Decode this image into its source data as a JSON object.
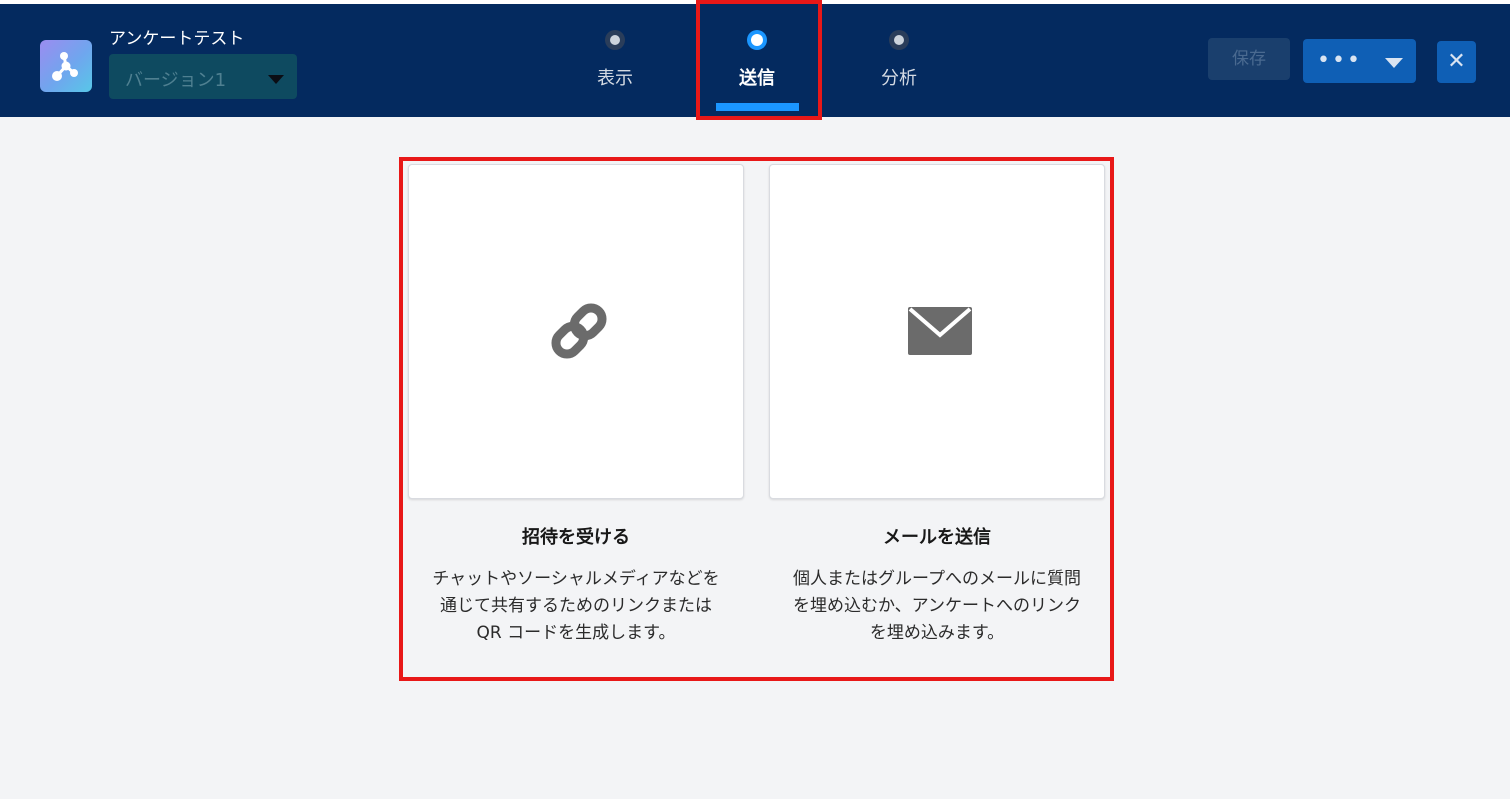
{
  "header": {
    "app_title": "アンケートテスト",
    "version_selected": "バージョン1",
    "steps": [
      {
        "label": "表示",
        "active": false
      },
      {
        "label": "送信",
        "active": true
      },
      {
        "label": "分析",
        "active": false
      }
    ],
    "save_label": "保存",
    "more_label": "•••",
    "close_label": "✕"
  },
  "cards": [
    {
      "icon": "link-icon",
      "title": "招待を受ける",
      "description": [
        "チャットやソーシャルメディアなどを",
        "通じて共有するためのリンクまたは",
        "QR コードを生成します。"
      ]
    },
    {
      "icon": "email-icon",
      "title": "メールを送信",
      "description": [
        "個人またはグループへのメールに質問",
        "を埋め込むか、アンケートへのリンク",
        "を埋め込みます。"
      ]
    }
  ],
  "colors": {
    "header_bg": "#042a5f",
    "accent": "#1b96ff",
    "highlight": "#e81818",
    "page_bg": "#f3f4f6"
  }
}
